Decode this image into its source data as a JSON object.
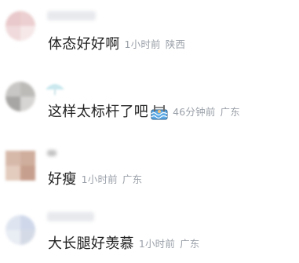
{
  "comments": [
    {
      "text": "体态好好啊",
      "time": "1小时前",
      "location": "陕西",
      "avatar_colors": [
        "#e9c9cb",
        "#eccfd0",
        "#f0dadb",
        "#f6e8e9"
      ]
    },
    {
      "text": "这样太标杆了吧",
      "emoji": "swimming-pool-emoji",
      "time": "46分钟前",
      "location": "广东",
      "avatar_colors": [
        "#c9c7c5",
        "#bdbbb8",
        "#a8a6a4",
        "#d7d5d3"
      ]
    },
    {
      "text": "好瘦",
      "time": "1小时前",
      "location": "广东",
      "avatar_colors": [
        "#d7b9aa",
        "#cfae9d",
        "#e3cbbd",
        "#c79f8e"
      ]
    },
    {
      "text": "大长腿好羡慕",
      "time": "1小时前",
      "location": "广东",
      "avatar_colors": [
        "#dfe5f0",
        "#cfd8ea",
        "#e9edf4",
        "#d5dbe6"
      ]
    }
  ]
}
